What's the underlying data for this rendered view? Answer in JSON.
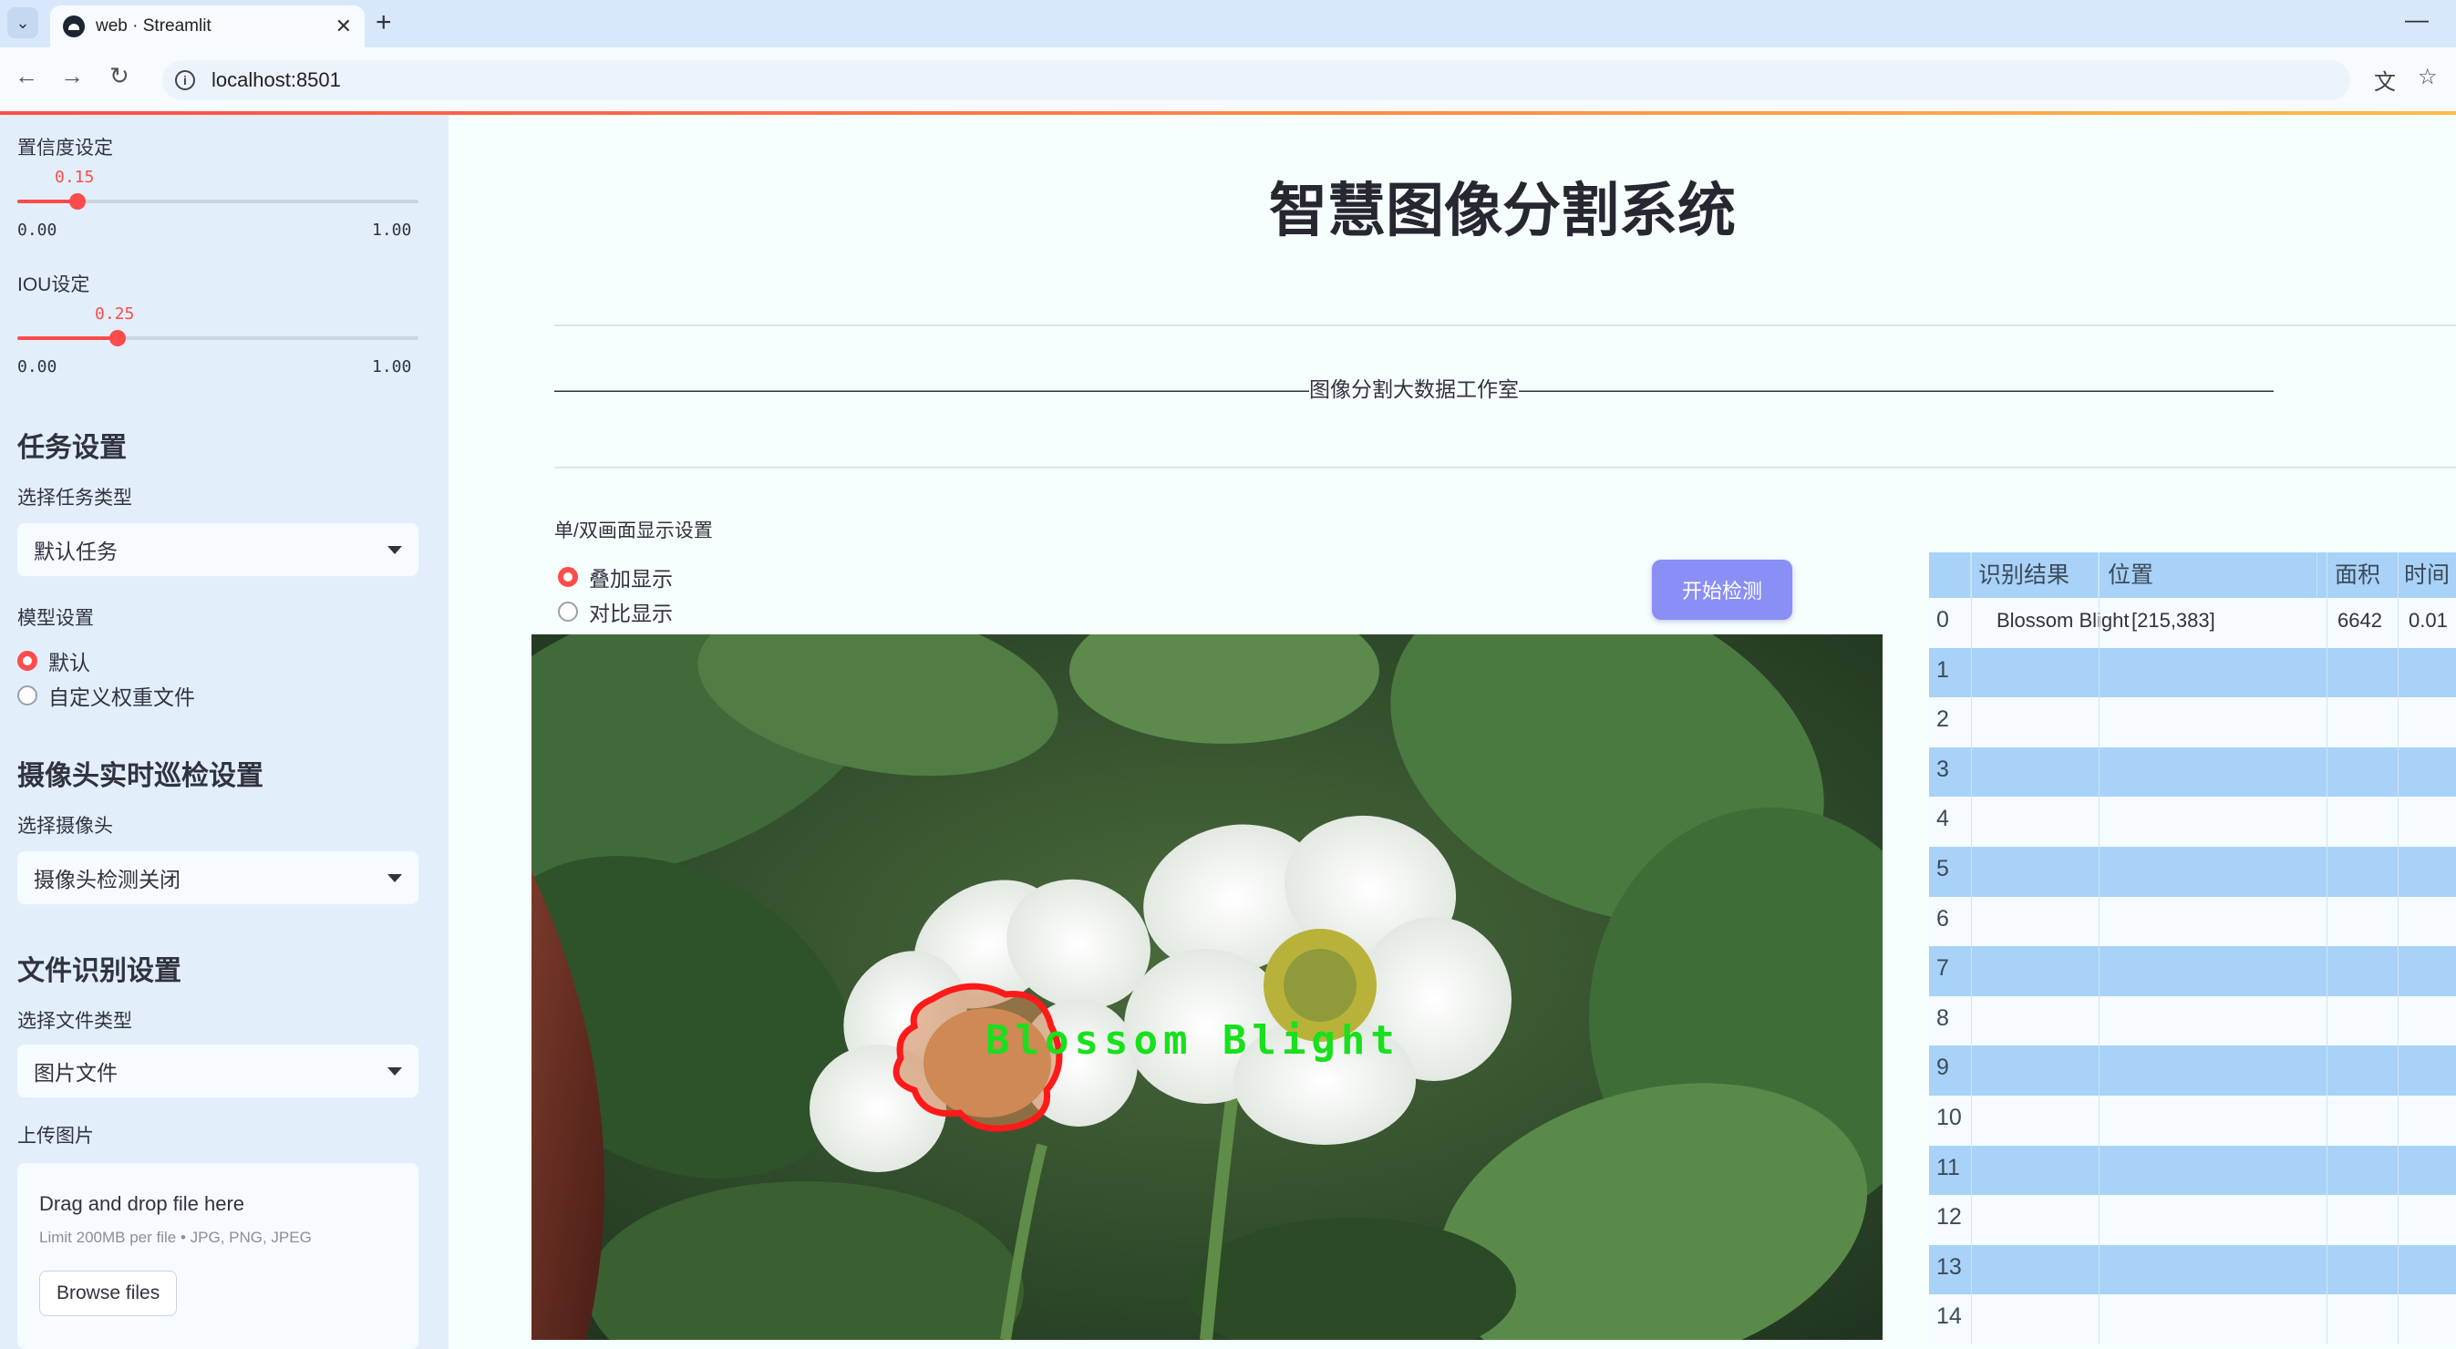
{
  "browser": {
    "tab_title": "web · Streamlit",
    "new_tab": "+",
    "url": "localhost:8501"
  },
  "sidebar": {
    "confidence": {
      "label": "置信度设定",
      "value": "0.15",
      "value_num": 0.15,
      "min": "0.00",
      "max": "1.00"
    },
    "iou": {
      "label": "IOU设定",
      "value": "0.25",
      "value_num": 0.25,
      "min": "0.00",
      "max": "1.00"
    },
    "task_heading": "任务设置",
    "task_type_label": "选择任务类型",
    "task_type_value": "默认任务",
    "model_label": "模型设置",
    "model_options": [
      "默认",
      "自定义权重文件"
    ],
    "camera_heading": "摄像头实时巡检设置",
    "camera_label": "选择摄像头",
    "camera_value": "摄像头检测关闭",
    "file_heading": "文件识别设置",
    "file_type_label": "选择文件类型",
    "file_type_value": "图片文件",
    "upload_label": "上传图片",
    "upload_title": "Drag and drop file here",
    "upload_limit": "Limit 200MB per file • JPG, PNG, JPEG",
    "browse_label": "Browse files"
  },
  "main": {
    "title": "智慧图像分割系统",
    "studio_line": "————————————————————————————————————图像分割大数据工作室————————————————————————————————————",
    "display_mode_label": "单/双画面显示设置",
    "display_options": [
      "叠加显示",
      "对比显示"
    ],
    "detect_button": "开始检测",
    "detection_label": "Blossom Blight"
  },
  "table": {
    "headers": [
      "识别结果",
      "位置",
      "面积",
      "时间"
    ],
    "rows": [
      {
        "index": "0",
        "result": "Blossom Blight",
        "position": "[215,383]",
        "area": "6642",
        "time": "0.01"
      },
      {
        "index": "1"
      },
      {
        "index": "2"
      },
      {
        "index": "3"
      },
      {
        "index": "4"
      },
      {
        "index": "5"
      },
      {
        "index": "6"
      },
      {
        "index": "7"
      },
      {
        "index": "8"
      },
      {
        "index": "9"
      },
      {
        "index": "10"
      },
      {
        "index": "11"
      },
      {
        "index": "12"
      },
      {
        "index": "13"
      },
      {
        "index": "14"
      }
    ]
  },
  "colors": {
    "accent": "#ff4b4b",
    "sidebar_bg": "#e2effb",
    "button": "#8a8ff5",
    "table_stripe": "#a8d2f7",
    "mask_outline": "#ff1a1a",
    "label_text": "#18e01c"
  }
}
